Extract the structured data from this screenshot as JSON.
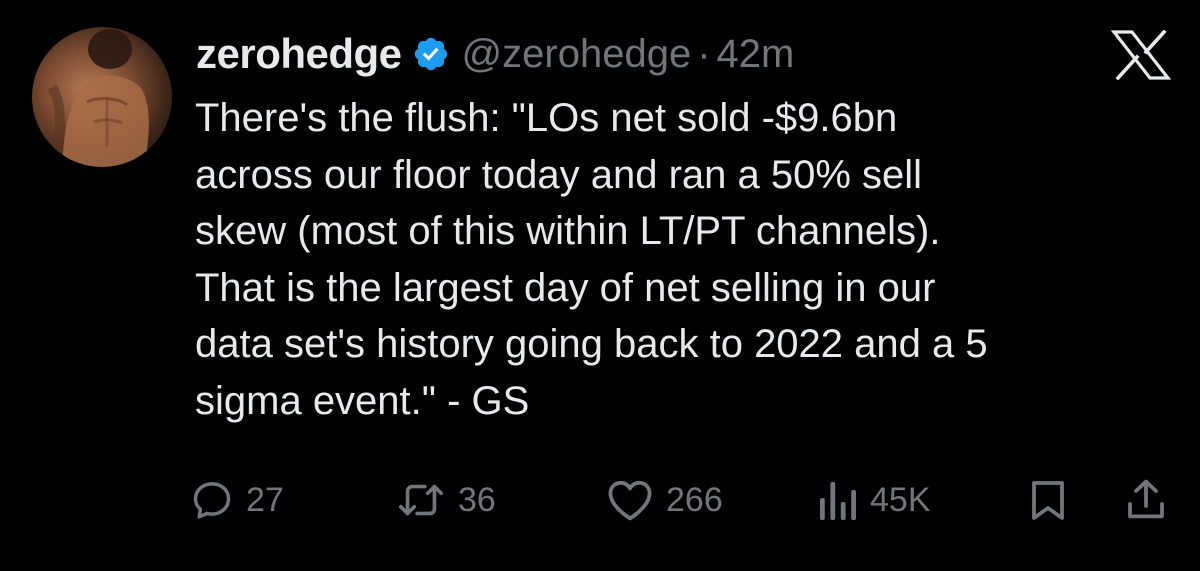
{
  "tweet": {
    "display_name": "zerohedge",
    "verified": true,
    "handle": "@zerohedge",
    "separator": "·",
    "time": "42m",
    "text_lines": [
      "There's the flush: \"LOs net sold -$9.6bn",
      "across our floor today and ran a 50% sell",
      "skew (most of this within LT/PT channels).",
      "That is the largest day of net selling in our",
      "data set's history going back to 2022 and a 5",
      "sigma event.\" - GS"
    ]
  },
  "actions": {
    "replies": "27",
    "reposts": "36",
    "likes": "266",
    "views": "45K"
  },
  "icons": {
    "reply": "reply-icon",
    "repost": "repost-icon",
    "like": "heart-icon",
    "views": "views-icon",
    "bookmark": "bookmark-icon",
    "share": "share-icon",
    "platform": "x-logo-icon",
    "verified": "verified-badge-icon"
  },
  "colors": {
    "background": "#000000",
    "text": "#e7e9ea",
    "secondary_text": "#71767b",
    "verified_blue": "#1d9bf0"
  }
}
